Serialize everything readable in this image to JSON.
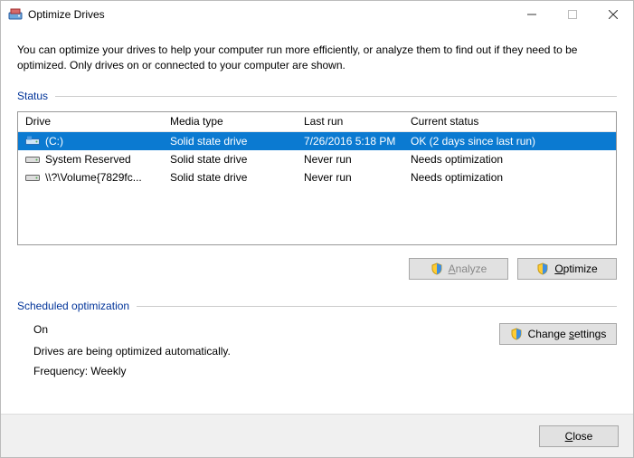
{
  "title": "Optimize Drives",
  "description": "You can optimize your drives to help your computer run more efficiently, or analyze them to find out if they need to be optimized. Only drives on or connected to your computer are shown.",
  "sections": {
    "status_label": "Status",
    "scheduled_label": "Scheduled optimization"
  },
  "columns": {
    "drive": "Drive",
    "media": "Media type",
    "last": "Last run",
    "status": "Current status"
  },
  "drives": [
    {
      "name": "(C:)",
      "icon": "drive-os-icon",
      "media": "Solid state drive",
      "last": "7/26/2016 5:18 PM",
      "status": "OK (2 days since last run)",
      "selected": true
    },
    {
      "name": "System Reserved",
      "icon": "drive-icon",
      "media": "Solid state drive",
      "last": "Never run",
      "status": "Needs optimization",
      "selected": false
    },
    {
      "name": "\\\\?\\Volume{7829fc...",
      "icon": "drive-icon",
      "media": "Solid state drive",
      "last": "Never run",
      "status": "Needs optimization",
      "selected": false
    }
  ],
  "buttons": {
    "analyze_pre": "",
    "analyze_u": "A",
    "analyze_post": "nalyze",
    "optimize_pre": "",
    "optimize_u": "O",
    "optimize_post": "ptimize",
    "change_pre": "Change ",
    "change_u": "s",
    "change_post": "ettings",
    "close_pre": "",
    "close_u": "C",
    "close_post": "lose"
  },
  "schedule": {
    "state": "On",
    "line1": "Drives are being optimized automatically.",
    "line2": "Frequency: Weekly"
  }
}
